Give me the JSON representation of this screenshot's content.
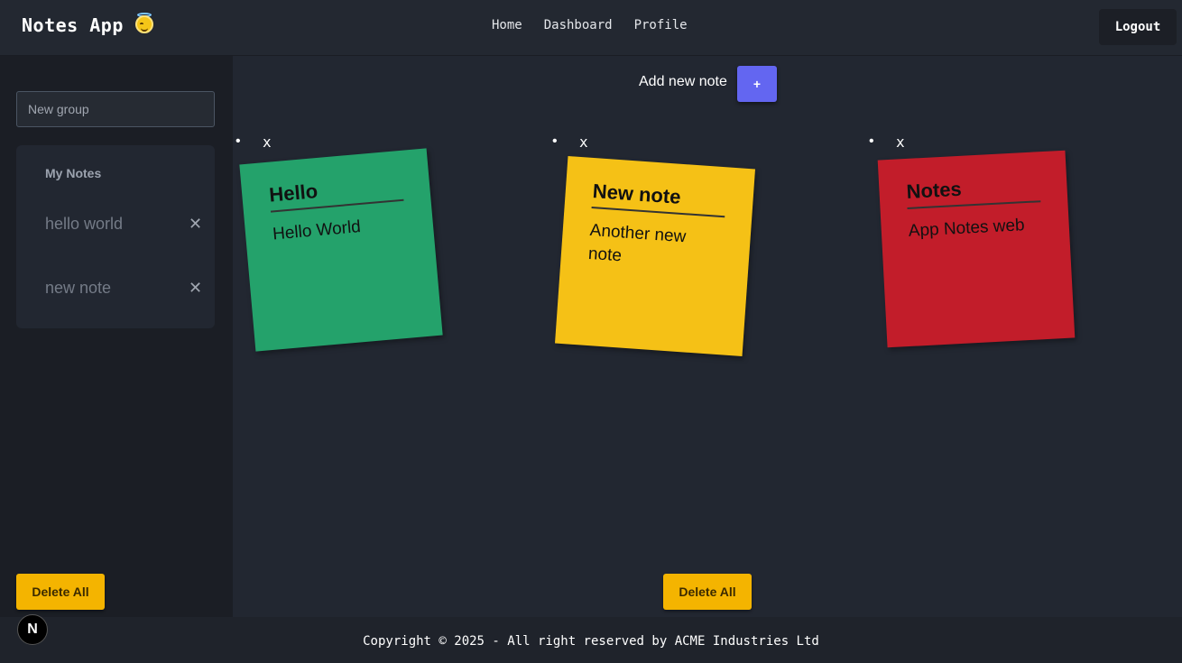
{
  "header": {
    "title": "Notes App",
    "emoji_icon": "smiling-face-with-halo",
    "nav": [
      "Home",
      "Dashboard",
      "Profile"
    ],
    "logout_label": "Logout"
  },
  "sidebar": {
    "new_group_placeholder": "New group",
    "group_title": "My Notes",
    "groups": [
      {
        "label": "hello world"
      },
      {
        "label": "new note"
      }
    ],
    "delete_all_label": "Delete All"
  },
  "main": {
    "add_label": "Add new note",
    "add_button": "+",
    "bullet": "•",
    "remove_label": "x",
    "notes": [
      {
        "title": "Hello",
        "body": "Hello World",
        "color": "#24a26b"
      },
      {
        "title": "New note",
        "body": "Another new note",
        "color": "#f5c116"
      },
      {
        "title": "Notes",
        "body": "App Notes web",
        "color": "#c21d2a"
      }
    ],
    "delete_all_label": "Delete All"
  },
  "footer": {
    "text": "Copyright © 2025 - All right reserved by ACME Industries Ltd"
  },
  "badge": {
    "letter": "N"
  },
  "colors": {
    "accent": "#6366f1",
    "warning": "#f4b400",
    "background": "#222731"
  }
}
